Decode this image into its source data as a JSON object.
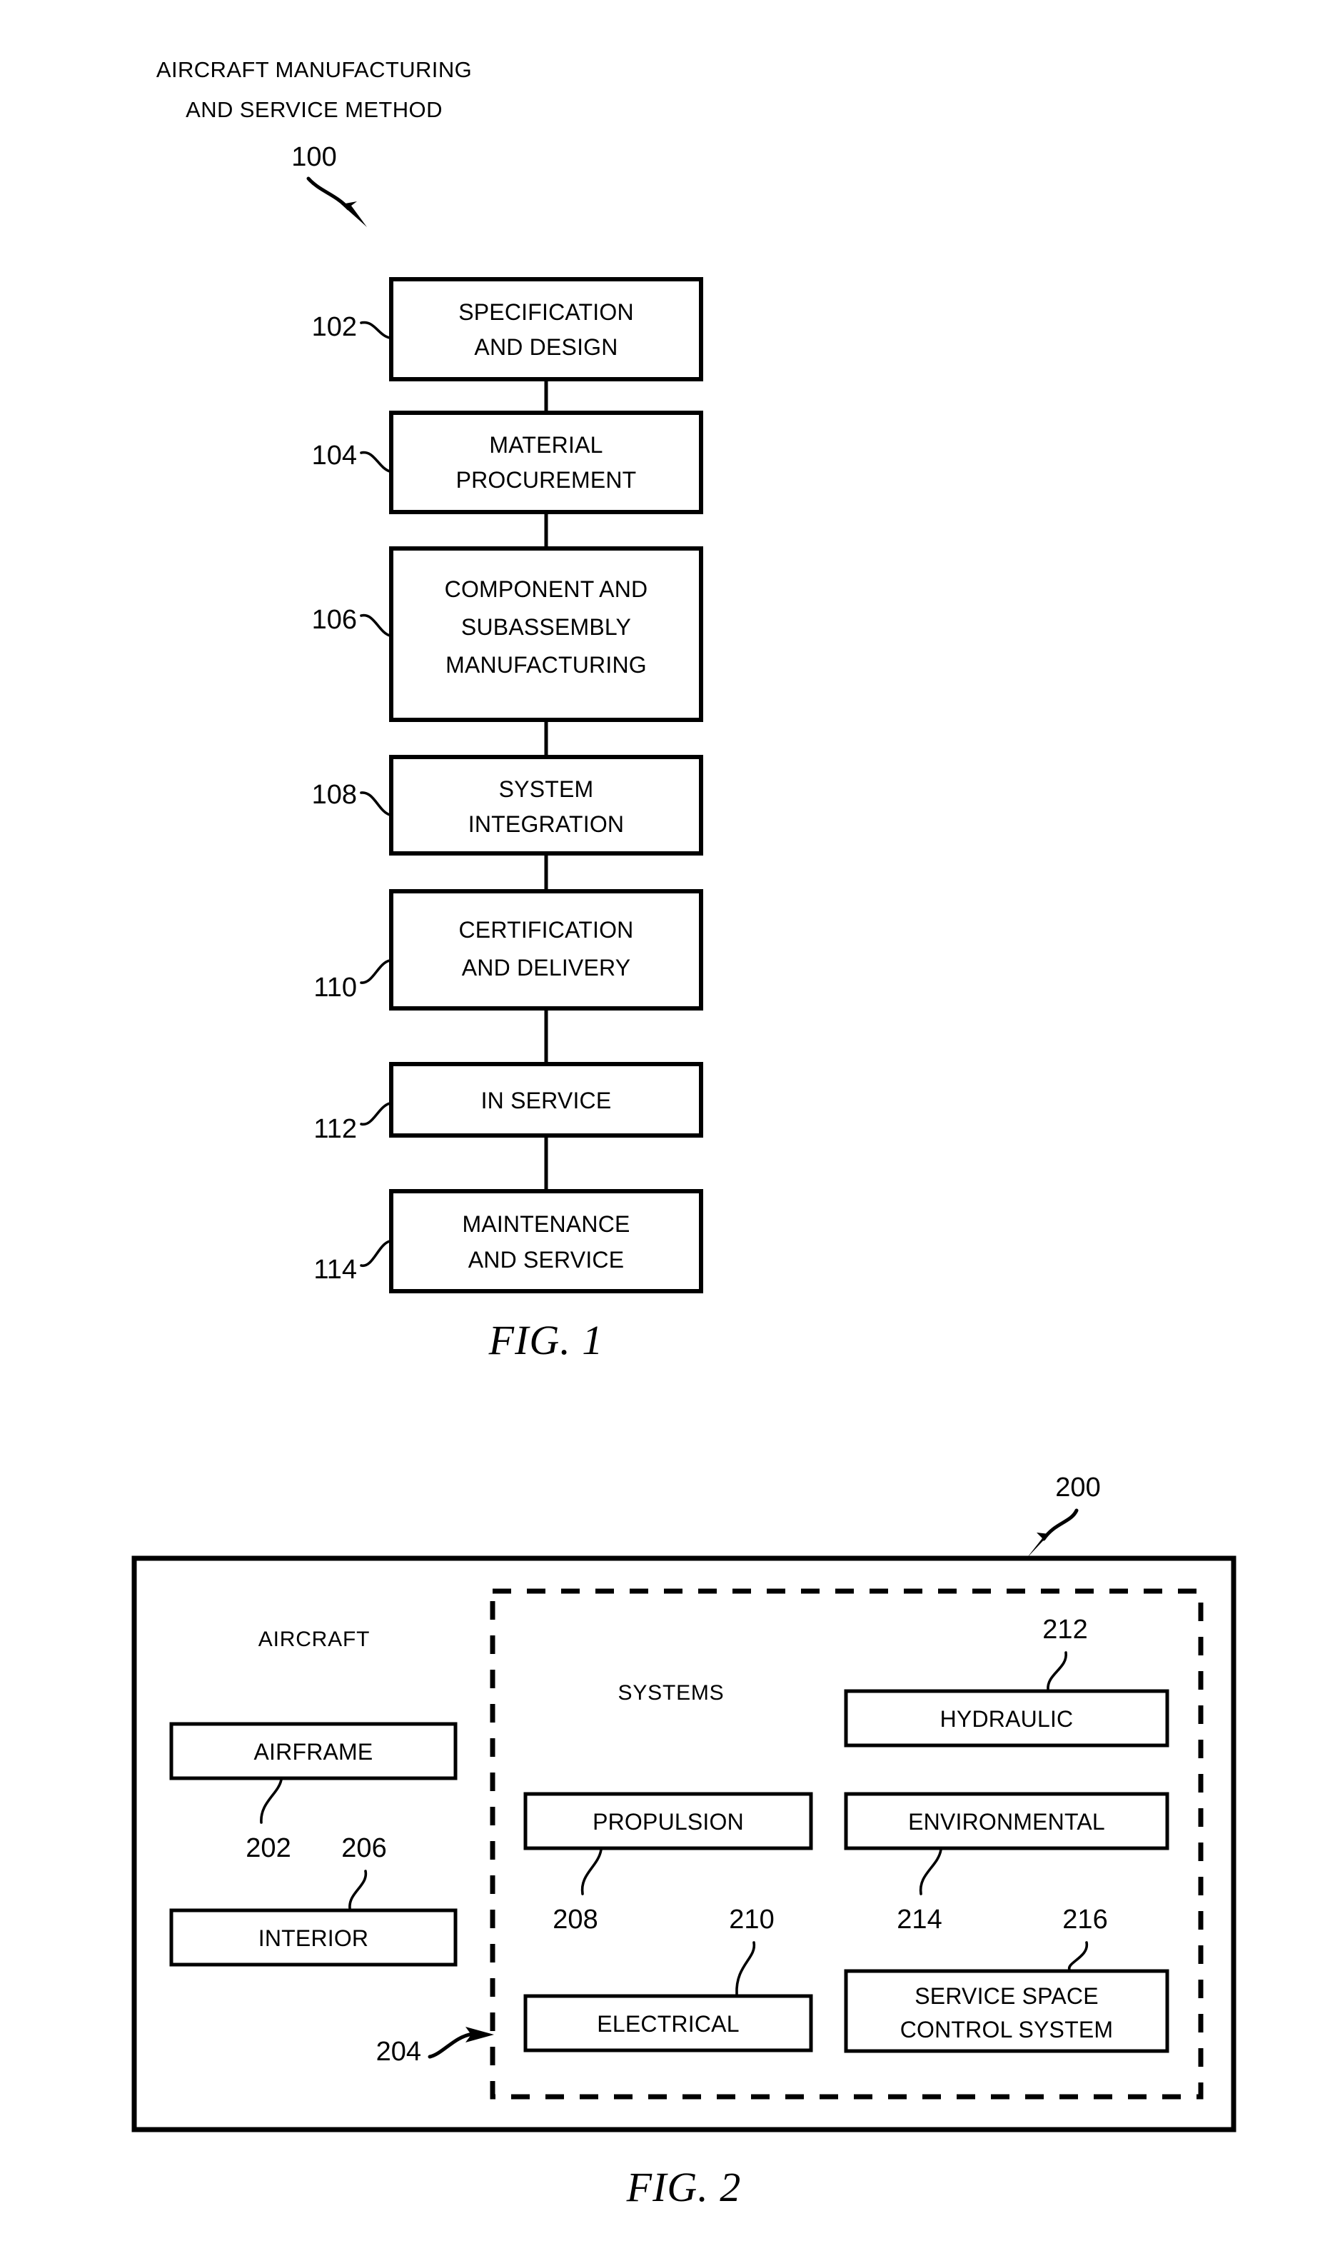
{
  "sheet": {
    "background": "#ffffff",
    "ink": "#000000"
  },
  "figure1": {
    "caption": "FIG. 1",
    "title_line1": "AIRCRAFT MANUFACTURING",
    "title_line2": "AND SERVICE METHOD",
    "title_ref": "100",
    "steps": [
      {
        "ref": "102",
        "line1": "SPECIFICATION",
        "line2": "AND DESIGN",
        "line3": ""
      },
      {
        "ref": "104",
        "line1": "MATERIAL",
        "line2": "PROCUREMENT",
        "line3": ""
      },
      {
        "ref": "106",
        "line1": "COMPONENT AND",
        "line2": "SUBASSEMBLY",
        "line3": "MANUFACTURING"
      },
      {
        "ref": "108",
        "line1": "SYSTEM",
        "line2": "INTEGRATION",
        "line3": ""
      },
      {
        "ref": "110",
        "line1": "CERTIFICATION",
        "line2": "AND DELIVERY",
        "line3": ""
      },
      {
        "ref": "112",
        "line1": "IN SERVICE",
        "line2": "",
        "line3": ""
      },
      {
        "ref": "114",
        "line1": "MAINTENANCE",
        "line2": "AND SERVICE",
        "line3": ""
      }
    ]
  },
  "figure2": {
    "caption": "FIG. 2",
    "outer_ref": "200",
    "aircraft_label": "AIRCRAFT",
    "systems_label": "SYSTEMS",
    "systems_ref": "204",
    "aircraft_boxes": [
      {
        "ref": "202",
        "label": "AIRFRAME"
      },
      {
        "ref": "206",
        "label": "INTERIOR"
      }
    ],
    "systems_boxes_left": [
      {
        "ref": "208",
        "label": "PROPULSION"
      },
      {
        "ref": "210",
        "label": "ELECTRICAL"
      }
    ],
    "systems_boxes_right": [
      {
        "ref": "212",
        "label": "HYDRAULIC"
      },
      {
        "ref": "214",
        "label": "ENVIRONMENTAL"
      },
      {
        "ref": "216",
        "label_line1": "SERVICE SPACE",
        "label_line2": "CONTROL SYSTEM"
      }
    ]
  }
}
